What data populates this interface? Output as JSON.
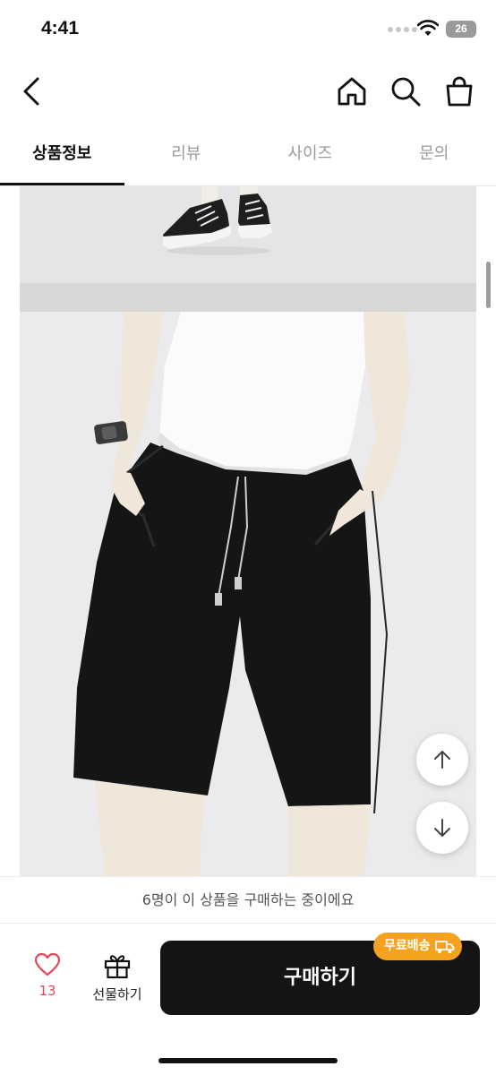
{
  "status_bar": {
    "time": "4:41",
    "battery": "26"
  },
  "header": {
    "icons": [
      "back-icon",
      "home-icon",
      "search-icon",
      "shopping-bag-icon"
    ]
  },
  "tabs": [
    {
      "label": "상품정보",
      "active": true
    },
    {
      "label": "리뷰",
      "active": false
    },
    {
      "label": "사이즈",
      "active": false
    },
    {
      "label": "문의",
      "active": false
    }
  ],
  "floating": {
    "icons": [
      "arrow-up-icon",
      "arrow-down-icon"
    ]
  },
  "notice": {
    "text": "6명이 이 상품을 구매하는 중이에요"
  },
  "bottom": {
    "like_count": "13",
    "gift_label": "선물하기",
    "buy_label": "구매하기",
    "free_shipping_badge": "무료배송"
  },
  "colors": {
    "accent_badge": "#f5a31f",
    "like": "#e8445a",
    "buy_button": "#141414"
  }
}
